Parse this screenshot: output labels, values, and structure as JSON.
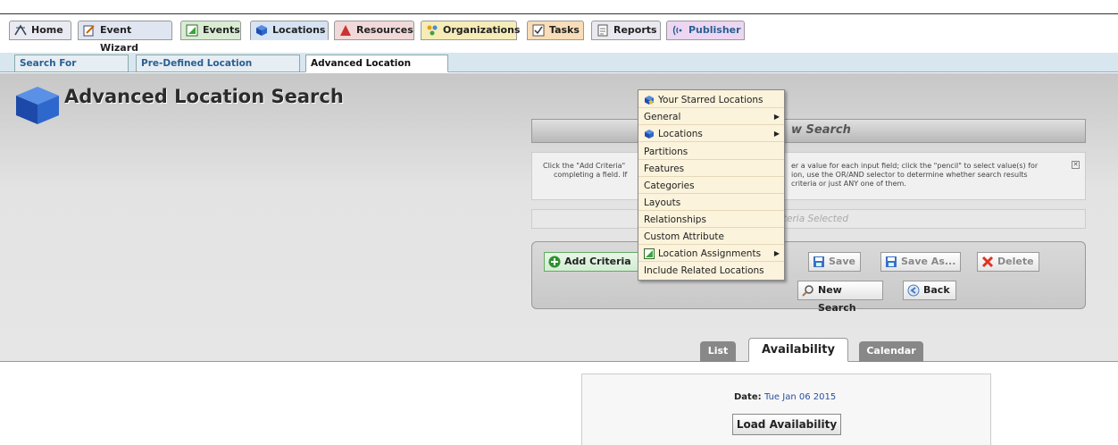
{
  "nav": {
    "tabs": [
      {
        "label": "Home"
      },
      {
        "label": "Event Wizard"
      },
      {
        "label": "Events"
      },
      {
        "label": "Locations"
      },
      {
        "label": "Resources"
      },
      {
        "label": "Organizations"
      },
      {
        "label": "Tasks"
      },
      {
        "label": "Reports"
      },
      {
        "label": "Publisher"
      }
    ]
  },
  "subnav": {
    "tabs": [
      {
        "label": "Search For Locations"
      },
      {
        "label": "Pre-Defined Location Searches"
      },
      {
        "label": "Advanced Location Search"
      }
    ]
  },
  "page": {
    "title": "Advanced Location Search"
  },
  "panel": {
    "header_partial": "w Search",
    "info_left_1": "Click the \"Add Criteria\"",
    "info_left_2": "completing a field. If",
    "info_right_1": "er a value for each input field; click the \"pencil\" to select value(s) for",
    "info_right_2": "ion, use the OR/AND selector to determine whether search results",
    "info_right_3": "criteria or just ANY one of them.",
    "close_glyph": "✕",
    "criteria_placeholder": "iteria Selected"
  },
  "toolbar": {
    "add_criteria": "Add Criteria",
    "save": "Save",
    "save_as": "Save As...",
    "delete": "Delete",
    "new_search": "New Search",
    "back": "Back"
  },
  "view_tabs": {
    "list": "List",
    "availability": "Availability",
    "calendar": "Calendar"
  },
  "availability": {
    "date_label": "Date:",
    "date_value": "Tue Jan 06 2015",
    "load_button": "Load Availability"
  },
  "menu": {
    "items": [
      {
        "label": "Your Starred Locations",
        "icon": "star-location-icon",
        "submenu": false
      },
      {
        "label": "General",
        "submenu": true
      },
      {
        "label": "Locations",
        "icon": "cube-icon",
        "submenu": true
      },
      {
        "label": "Partitions",
        "submenu": false
      },
      {
        "label": "Features",
        "submenu": false
      },
      {
        "label": "Categories",
        "submenu": false
      },
      {
        "label": "Layouts",
        "submenu": false
      },
      {
        "label": "Relationships",
        "submenu": false
      },
      {
        "label": "Custom Attribute",
        "submenu": false
      },
      {
        "label": "Location Assignments",
        "icon": "assignment-icon",
        "submenu": true
      },
      {
        "label": "Include Related Locations",
        "submenu": false
      }
    ]
  },
  "colors": {
    "tab_home": "#e9eaf2",
    "tab_wizard": "#dfe6f1",
    "tab_events": "#d9ecd3",
    "tab_locations": "#d6e3f3",
    "tab_resources": "#f2d9d9",
    "tab_orgs": "#f6ecb8",
    "tab_tasks": "#f8ddb8",
    "tab_reports": "#e9e9ef",
    "tab_publisher": "#ecd6f2",
    "menu_bg": "#fbf3dc",
    "link_blue": "#2a5f92"
  }
}
